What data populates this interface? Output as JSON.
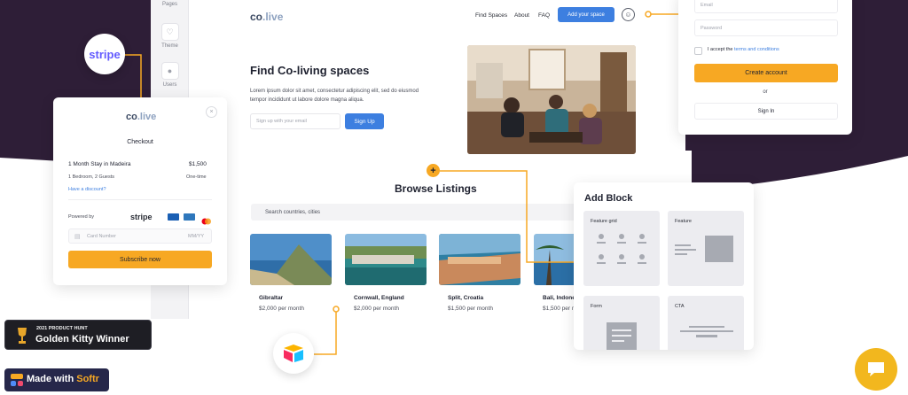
{
  "colors": {
    "dark_bg": "#2e1e37",
    "accent_orange": "#f7a823",
    "primary_blue": "#3d7fe0",
    "stripe_purple": "#635bff"
  },
  "sidebar": {
    "items": [
      {
        "label": "Pages",
        "icon": "page-icon"
      },
      {
        "label": "Theme",
        "icon": "theme-icon"
      },
      {
        "label": "Users",
        "icon": "users-icon"
      }
    ]
  },
  "site": {
    "logo_prefix": "co",
    "logo_suffix": ".live",
    "nav": [
      "Find Spaces",
      "About",
      "FAQ"
    ],
    "nav_button": "Add your space",
    "hero_title": "Find Co-living spaces",
    "hero_subtitle": "Lorem ipsum dolor sit amet, consectetur adipiscing elit, sed do eiusmod tempor incididunt ut labore dolore magna aliqua.",
    "email_placeholder": "Sign up with your email",
    "signup_button": "Sign Up",
    "listings_title": "Browse Listings",
    "search_placeholder": "Search countries, cities",
    "listings": [
      {
        "name": "Gibraltar",
        "price": "$2,000 per month"
      },
      {
        "name": "Cornwall, England",
        "price": "$2,000 per month"
      },
      {
        "name": "Split, Croatia",
        "price": "$1,500 per month"
      },
      {
        "name": "Bali, Indonesia",
        "price": "$1,500 per month"
      }
    ]
  },
  "checkout": {
    "logo_prefix": "co",
    "logo_suffix": ".live",
    "close": "×",
    "heading": "Checkout",
    "item": "1 Month Stay in Madeira",
    "amount": "$1,500",
    "details": "1 Bedroom, 2 Guests",
    "frequency": "One-time",
    "discount_link": "Have a discount?",
    "powered_by": "Powered by",
    "processor": "stripe",
    "card_placeholder": "Card Number",
    "expiry_placeholder": "MM/YY",
    "subscribe_button": "Subscribe now"
  },
  "stripe_badge": "stripe",
  "signup_card": {
    "email_placeholder": "Email",
    "password_placeholder": "Password",
    "terms_prefix": "I accept the ",
    "terms_link": "terms and conditions",
    "create_button": "Create account",
    "or_text": "or",
    "signin_button": "Sign In"
  },
  "add_block": {
    "title": "Add Block",
    "tiles": [
      "Feature grid",
      "Feature",
      "Form",
      "CTA"
    ]
  },
  "badges": {
    "ph_small": "2021 PRODUCT HUNT",
    "ph_big": "Golden Kitty Winner",
    "made_with": "Made with ",
    "softr": "Softr"
  }
}
